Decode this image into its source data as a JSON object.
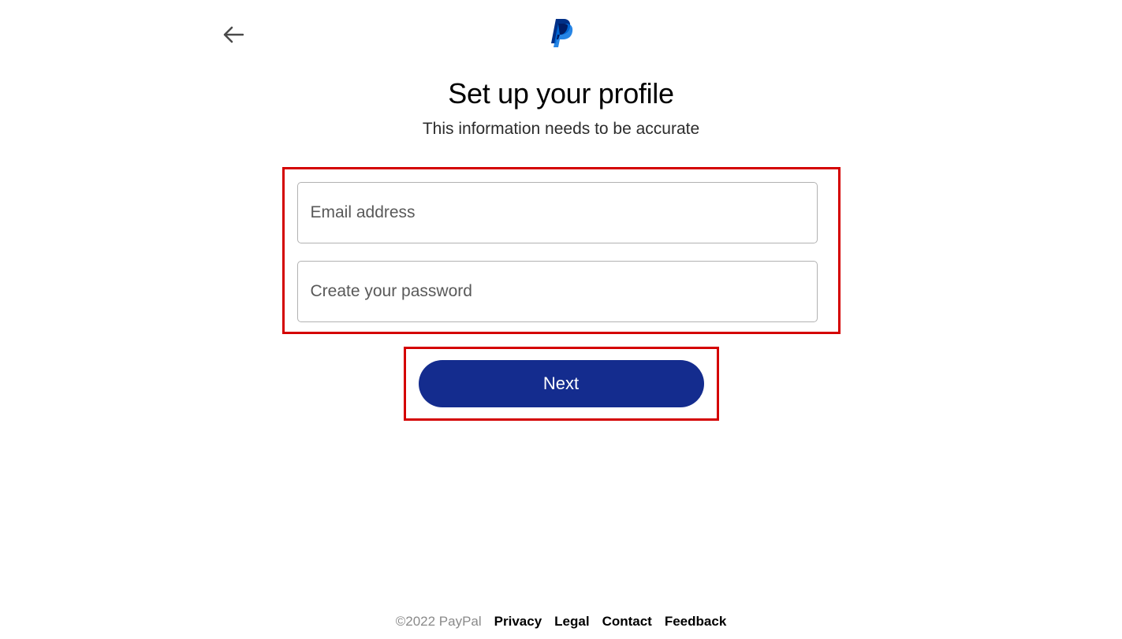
{
  "header": {
    "title": "Set up your profile",
    "subtitle": "This information needs to be accurate"
  },
  "form": {
    "email_placeholder": "Email address",
    "password_placeholder": "Create your password",
    "next_button_label": "Next"
  },
  "footer": {
    "copyright": "©2022 PayPal",
    "links": [
      "Privacy",
      "Legal",
      "Contact",
      "Feedback"
    ]
  }
}
